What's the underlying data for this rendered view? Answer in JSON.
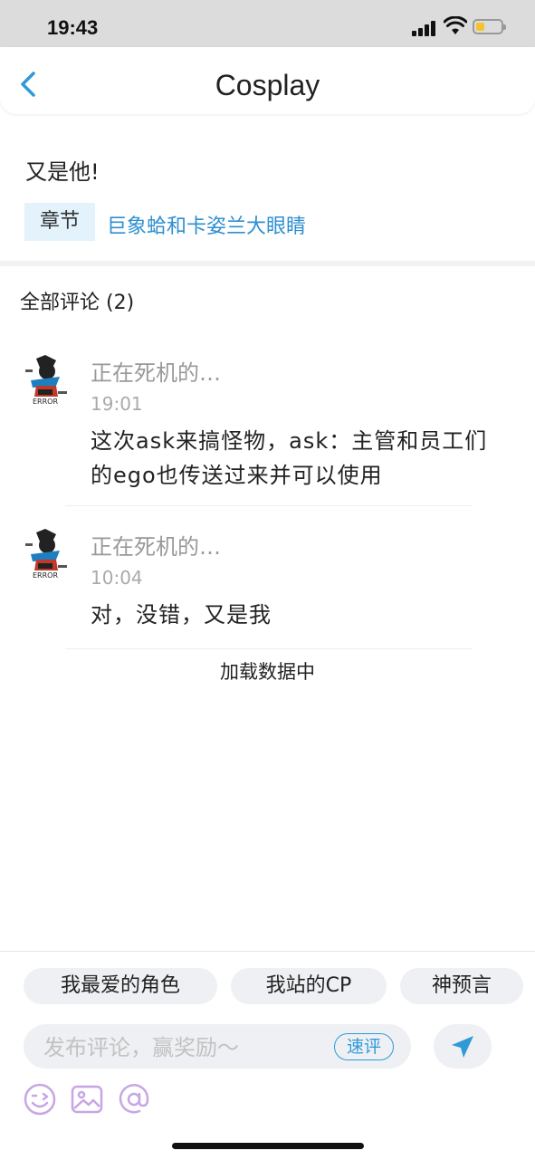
{
  "status_bar": {
    "time": "19:43"
  },
  "header": {
    "title": "Cosplay"
  },
  "post": {
    "title": "又是他!",
    "chapter_tag": "章节",
    "chapter_name": "巨象蛤和卡姿兰大眼睛"
  },
  "comments_header": "全部评论 (2)",
  "comments": [
    {
      "name": "正在死机的…",
      "time": "19:01",
      "text": "这次ask来搞怪物，ask：主管和员工们的ego也传送过来并可以使用",
      "avatar_text": "ERROR"
    },
    {
      "name": "正在死机的…",
      "time": "10:04",
      "text": "对，没错，又是我",
      "avatar_text": "ERROR"
    }
  ],
  "loading_text": "加载数据中",
  "quick_chips": [
    "我最爱的角色",
    "我站的CP",
    "神预言"
  ],
  "input": {
    "placeholder": "发布评论，赢奖励～",
    "quick_review": "速评"
  },
  "icons": [
    "back-icon",
    "send-icon",
    "emoji-icon",
    "image-icon",
    "mention-icon"
  ],
  "colors": {
    "accent": "#2e8fd1",
    "tag_bg": "#e3f2fb",
    "icon_purple": "#c7a6e6"
  }
}
